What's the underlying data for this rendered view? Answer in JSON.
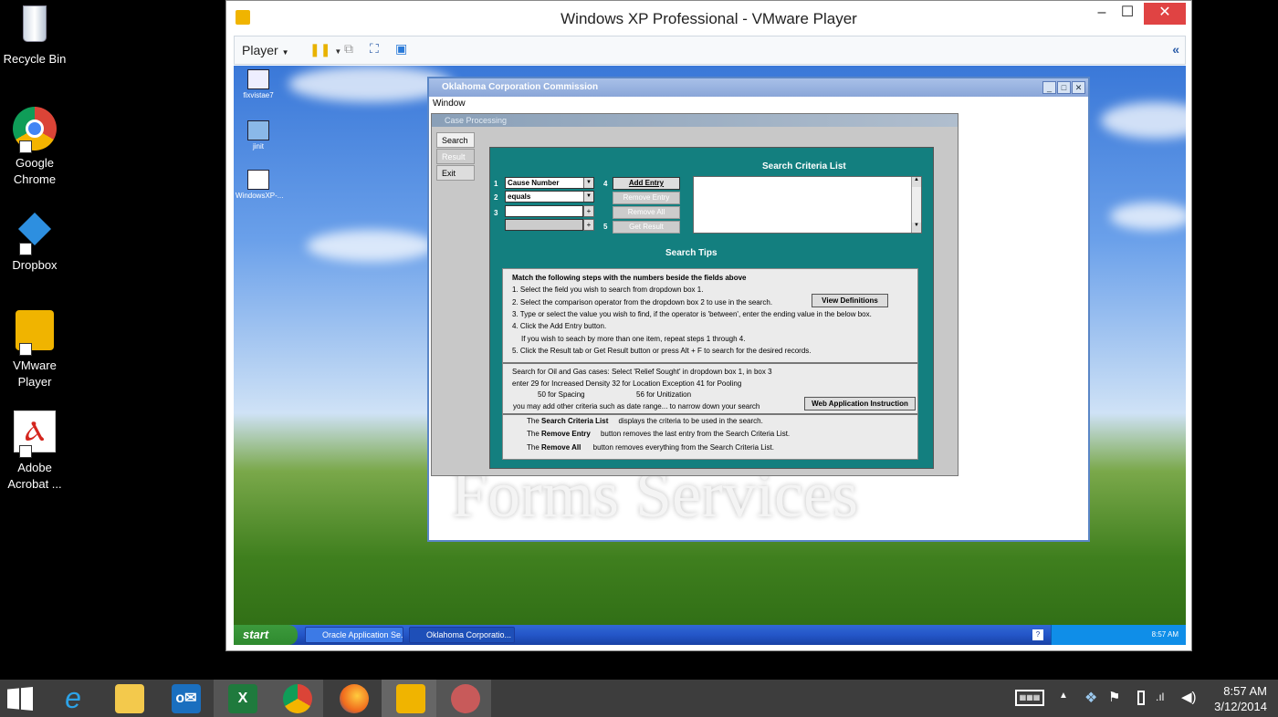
{
  "desktop_icons": [
    {
      "label": "Recycle Bin",
      "icon": "recycle-bin-icon"
    },
    {
      "label": "Google Chrome",
      "icon": "chrome-icon"
    },
    {
      "label": "Dropbox",
      "icon": "dropbox-icon"
    },
    {
      "label": "VMware Player",
      "icon": "vmware-icon"
    },
    {
      "label": "Adobe Acrobat ...",
      "icon": "acrobat-icon"
    }
  ],
  "vmware": {
    "title": "Windows XP Professional - VMware Player",
    "player_menu": "Player",
    "collapse": "«"
  },
  "xp_icons": [
    {
      "label": "fixvistae7"
    },
    {
      "label": "jinit"
    },
    {
      "label": "WindowsXP-..."
    }
  ],
  "xp_taskbar": {
    "start": "start",
    "tasks": [
      "Oracle Application Se...",
      "Oklahoma Corporatio..."
    ],
    "time": "8:57 AM"
  },
  "occ": {
    "title": "Oklahoma Corporation Commission",
    "menu": "Window",
    "watermark": "Forms Services"
  },
  "case": {
    "title": "Case Processing",
    "tabs": [
      "Search",
      "Result",
      "Exit"
    ],
    "criteria_title": "Search Criteria List",
    "field1": "Cause Number",
    "field2": "equals",
    "field3": "",
    "field4": "",
    "nums": [
      "1",
      "2",
      "3",
      "4",
      "5"
    ],
    "buttons": [
      "Add Entry",
      "Remove Entry",
      "Remove All",
      "Get Result"
    ],
    "tips_title": "Search Tips",
    "tips": [
      "Match the following steps with the numbers beside the fields above",
      "1. Select the field you wish to search from dropdown box 1.",
      "2. Select the comparison operator from the dropdown box 2 to use in the search.",
      "3. Type or select the value you wish to find, if the operator is 'between', enter the ending value in the below box.",
      "4. Click the Add Entry button.",
      "If you wish to seach by more than one item, repeat steps 1 through 4.",
      "5. Click the Result tab or Get Result button or press Alt + F to search for the desired records."
    ],
    "view_definitions": "View Definitions",
    "oil_gas": [
      "Search for Oil and Gas cases: Select  'Relief Sought' in dropdown box 1, in box 3",
      "enter   29  for Increased Density   32  for Location Exception      41 for Pooling",
      "50  for Spacing",
      "56  for Unitization",
      "you may add other criteria such as date range... to narrow down your search"
    ],
    "web_instruction": "Web Application Instruction",
    "legend": [
      {
        "pre": "The",
        "bold": "Search Criteria List",
        "post": "displays the criteria to be used in the search."
      },
      {
        "pre": "The",
        "bold": "Remove Entry",
        "post": "button removes the last entry from the Search Criteria List."
      },
      {
        "pre": "The",
        "bold": "Remove All",
        "post": "button removes everything from the Search Criteria List."
      }
    ]
  },
  "clock": {
    "time": "8:57 AM",
    "date": "3/12/2014"
  }
}
